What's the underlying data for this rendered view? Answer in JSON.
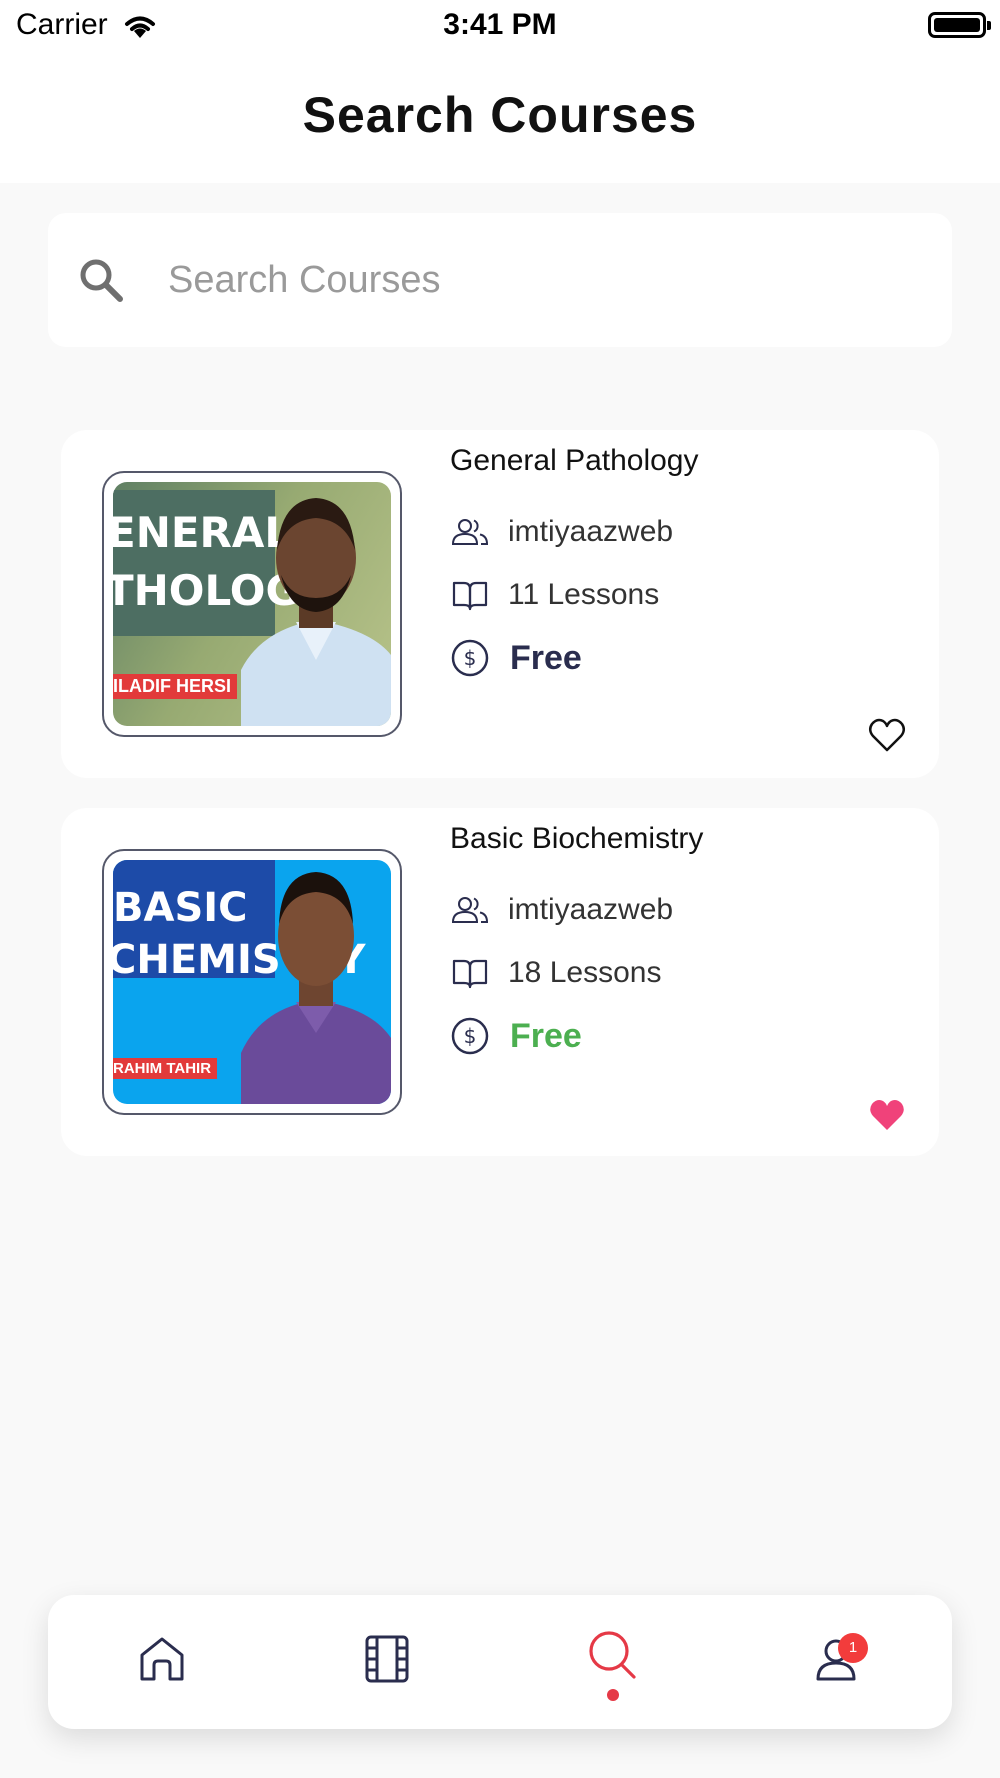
{
  "status_bar": {
    "carrier": "Carrier",
    "time": "3:41 PM",
    "wifi_icon": "wifi-icon",
    "battery_icon": "battery-icon"
  },
  "header": {
    "title": "Search Courses"
  },
  "search": {
    "placeholder": "Search Courses",
    "value": "",
    "icon": "search-icon"
  },
  "courses": [
    {
      "title": "General Pathology",
      "author": "imtiyaazweb",
      "lessons": "11 Lessons",
      "price": "Free",
      "price_color": "#2a2d4e",
      "favorite": false,
      "thumbnail": {
        "line1": "ENERAL",
        "line2": "THOLOGY",
        "tag": "ILADIF HERSI"
      }
    },
    {
      "title": "Basic Biochemistry",
      "author": "imtiyaazweb",
      "lessons": "18 Lessons",
      "price": "Free",
      "price_color": "#4caf50",
      "favorite": true,
      "thumbnail": {
        "line1": "BASIC",
        "line2": "CHEMISTRY",
        "tag": "RAHIM TAHIR"
      }
    }
  ],
  "icons": {
    "author": "users-icon",
    "lessons": "book-open-icon",
    "price": "dollar-circle-icon",
    "favorite_off": "heart-outline-icon",
    "favorite_on": "heart-filled-icon"
  },
  "bottom_nav": {
    "items": [
      {
        "icon": "home-icon",
        "active": false
      },
      {
        "icon": "film-icon",
        "active": false
      },
      {
        "icon": "search-icon",
        "active": true
      },
      {
        "icon": "user-icon",
        "active": false
      }
    ],
    "profile_badge": "1",
    "active_color": "#e53946",
    "inactive_color": "#2a2d4e"
  },
  "colors": {
    "background": "#f9f9f9",
    "accent": "#e53946",
    "heart": "#f0427a"
  }
}
